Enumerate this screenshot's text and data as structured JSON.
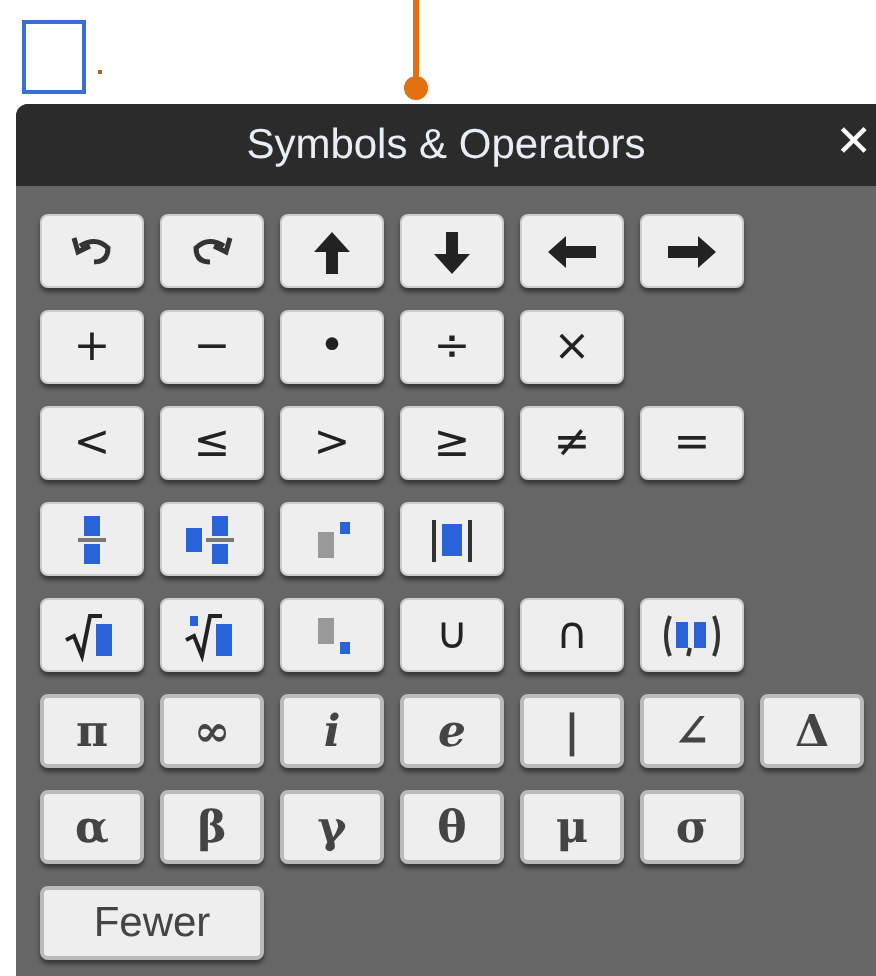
{
  "panel": {
    "title": "Symbols & Operators",
    "close": "✕"
  },
  "rows": [
    [
      {
        "kind": "undo"
      },
      {
        "kind": "redo"
      },
      {
        "kind": "arrow-up"
      },
      {
        "kind": "arrow-down"
      },
      {
        "kind": "arrow-left"
      },
      {
        "kind": "arrow-right"
      }
    ],
    [
      {
        "kind": "text",
        "label": "+"
      },
      {
        "kind": "text",
        "label": "−"
      },
      {
        "kind": "text",
        "label": "•"
      },
      {
        "kind": "text",
        "label": "÷"
      },
      {
        "kind": "text",
        "label": "×"
      }
    ],
    [
      {
        "kind": "text",
        "label": "<"
      },
      {
        "kind": "text",
        "label": "≤"
      },
      {
        "kind": "text",
        "label": ">"
      },
      {
        "kind": "text",
        "label": "≥"
      },
      {
        "kind": "text",
        "label": "≠"
      },
      {
        "kind": "text",
        "label": "="
      }
    ],
    [
      {
        "kind": "fraction"
      },
      {
        "kind": "mixed"
      },
      {
        "kind": "superscript"
      },
      {
        "kind": "absolute"
      }
    ],
    [
      {
        "kind": "sqrt"
      },
      {
        "kind": "root"
      },
      {
        "kind": "subscript"
      },
      {
        "kind": "text",
        "label": "∪"
      },
      {
        "kind": "text",
        "label": "∩"
      },
      {
        "kind": "pair"
      }
    ],
    [
      {
        "kind": "greek",
        "label": "π"
      },
      {
        "kind": "greek",
        "label": "∞"
      },
      {
        "kind": "italic",
        "label": "i"
      },
      {
        "kind": "italic",
        "label": "e"
      },
      {
        "kind": "greek",
        "label": "|"
      },
      {
        "kind": "greek",
        "label": "∠"
      },
      {
        "kind": "greek",
        "label": "Δ"
      }
    ],
    [
      {
        "kind": "greek",
        "label": "α"
      },
      {
        "kind": "greek",
        "label": "β"
      },
      {
        "kind": "greek",
        "label": "γ"
      },
      {
        "kind": "greek",
        "label": "θ"
      },
      {
        "kind": "greek",
        "label": "μ"
      },
      {
        "kind": "greek",
        "label": "σ"
      }
    ]
  ],
  "fewer_button": "Fewer"
}
